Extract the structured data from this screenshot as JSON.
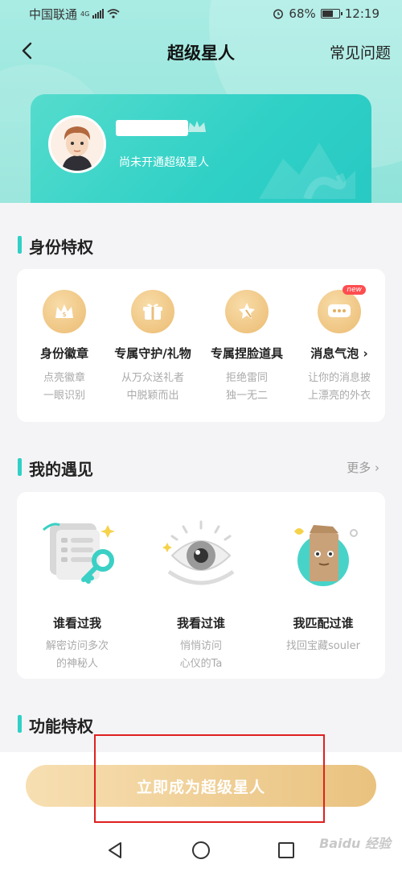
{
  "status_bar": {
    "carrier": "中国联通",
    "network": "4G",
    "battery": "68%",
    "time": "12:19"
  },
  "header": {
    "title": "超级星人",
    "faq": "常见问题"
  },
  "profile": {
    "status": "尚未开通超级星人"
  },
  "privileges": {
    "title": "身份特权",
    "items": [
      {
        "label": "身份徽章",
        "desc": [
          "点亮徽章",
          "一眼识别"
        ],
        "icon": "badge-icon"
      },
      {
        "label": "专属守护/礼物",
        "desc": [
          "从万众送礼者",
          "中脱颖而出"
        ],
        "icon": "gift-icon"
      },
      {
        "label": "专属捏脸道具",
        "desc": [
          "拒绝雷同",
          "独一无二"
        ],
        "icon": "face-prop-icon"
      },
      {
        "label": "消息气泡",
        "desc": [
          "让你的消息披",
          "上漂亮的外衣"
        ],
        "icon": "bubble-icon",
        "badge": "new"
      }
    ]
  },
  "encounters": {
    "title": "我的遇见",
    "more": "更多",
    "items": [
      {
        "label": "谁看过我",
        "desc": [
          "解密访问多次",
          "的神秘人"
        ]
      },
      {
        "label": "我看过谁",
        "desc": [
          "悄悄访问",
          "心仪的Ta"
        ]
      },
      {
        "label": "我匹配过谁",
        "desc": [
          "找回宝藏souler"
        ]
      }
    ]
  },
  "features": {
    "title": "功能特权"
  },
  "cta": {
    "label": "立即成为超级星人"
  },
  "watermark": "Baidu 经验",
  "colors": {
    "accent": "#2fd0c6",
    "gold": "#e9c27f",
    "highlight": "#e02020"
  }
}
